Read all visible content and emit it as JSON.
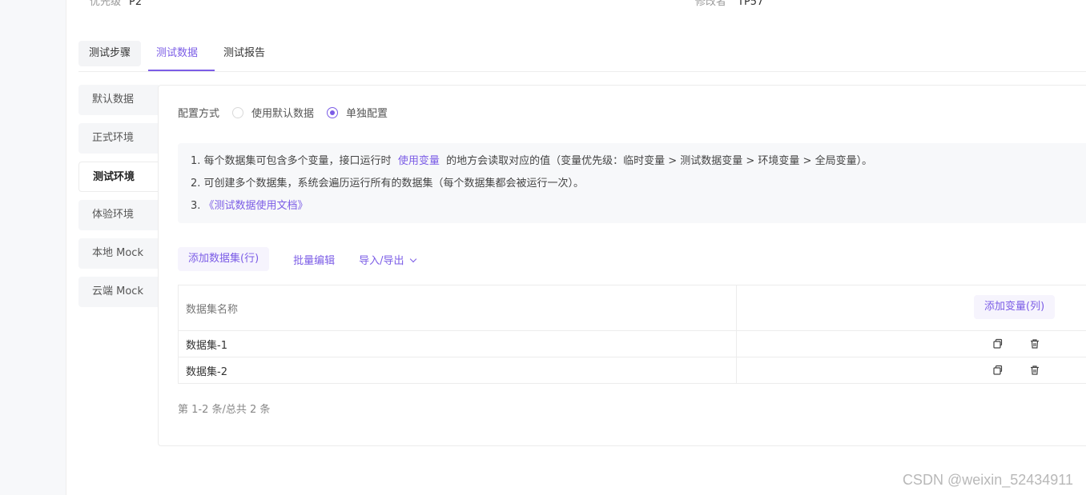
{
  "meta": {
    "priority_label": "优先级",
    "priority_value": "P2",
    "modifier_label": "修改者",
    "modifier_value": "TP57"
  },
  "tabs": [
    {
      "label": "测试步骤"
    },
    {
      "label": "测试数据"
    },
    {
      "label": "测试报告"
    }
  ],
  "environments": [
    {
      "label": "默认数据"
    },
    {
      "label": "正式环境"
    },
    {
      "label": "测试环境"
    },
    {
      "label": "体验环境"
    },
    {
      "label": "本地 Mock"
    },
    {
      "label": "云端 Mock"
    }
  ],
  "config": {
    "label": "配置方式",
    "options": [
      {
        "label": "使用默认数据",
        "checked": false
      },
      {
        "label": "单独配置",
        "checked": true
      }
    ]
  },
  "info": {
    "line1_prefix": "1. 每个数据集可包含多个变量，接口运行时",
    "line1_link": "使用变量",
    "line1_suffix": "的地方会读取对应的值（变量优先级：临时变量 > 测试数据变量 > 环境变量 > 全局变量）。",
    "line2": "2. 可创建多个数据集，系统会遍历运行所有的数据集（每个数据集都会被运行一次）。",
    "line3_prefix": "3. ",
    "line3_link": "《测试数据使用文档》"
  },
  "actions": {
    "add_dataset": "添加数据集(行)",
    "batch_edit": "批量编辑",
    "import_export": "导入/导出"
  },
  "table": {
    "header_name": "数据集名称",
    "add_variable": "添加变量(列)",
    "rows": [
      {
        "name": "数据集-1"
      },
      {
        "name": "数据集-2"
      }
    ]
  },
  "pagination": {
    "text": "第 1-2 条/总共 2 条"
  },
  "watermark": "CSDN @weixin_52434911",
  "colors": {
    "accent": "#7b5ce6",
    "panel_bg": "#f7f8fa"
  }
}
